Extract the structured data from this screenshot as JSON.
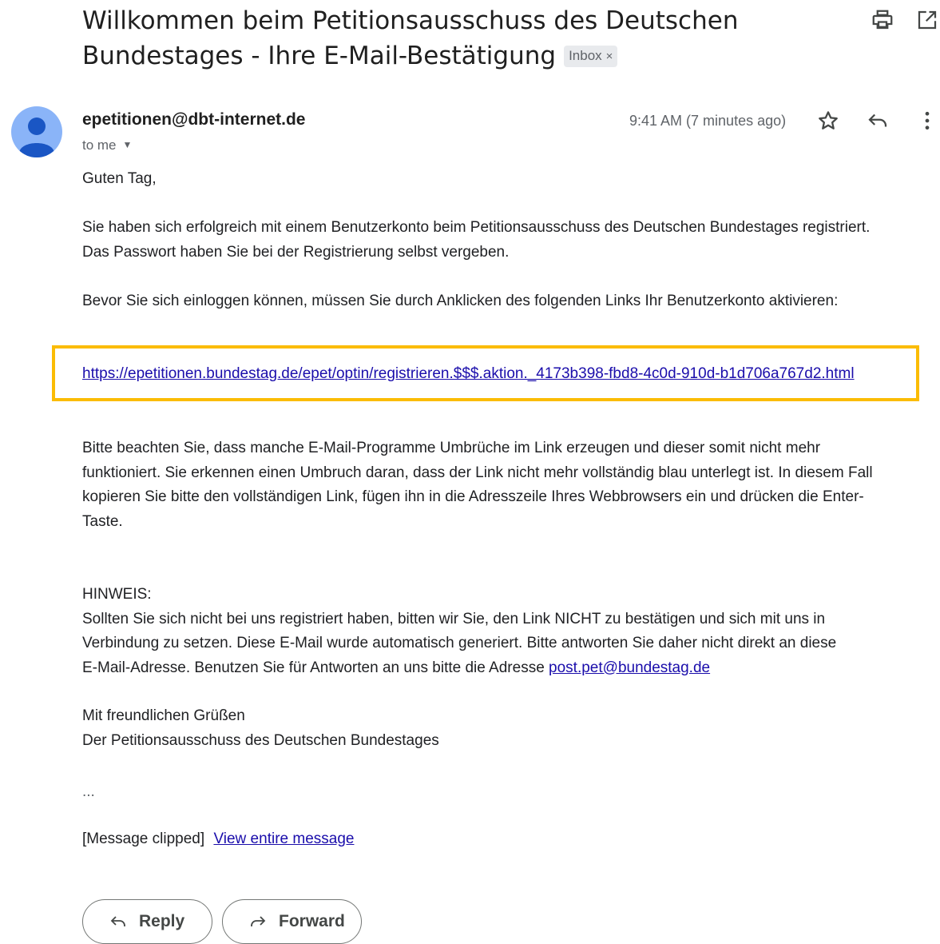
{
  "email": {
    "subject": "Willkommen beim Petitionsausschuss des Deutschen Bundestages - Ihre E-Mail-Bestätigung",
    "label": "Inbox",
    "sender": "epetitionen@dbt-internet.de",
    "recipient": "to me",
    "time": "9:41 AM (7 minutes ago)",
    "greeting": "Guten Tag,",
    "p1_line1": "Sie haben sich erfolgreich mit einem Benutzerkonto beim Petitionsausschuss des Deutschen Bundestages registriert.",
    "p1_line2": "Das Passwort haben Sie bei der Registrierung selbst vergeben.",
    "p2": "Bevor Sie sich einloggen können, müssen Sie durch Anklicken des folgenden Links Ihr Benutzerkonto aktivieren:",
    "activation_link": "https://epetitionen.bundestag.de/epet/optin/registrieren.$$$.aktion._4173b398-fbd8-4c0d-910d-b1d706a767d2.html",
    "p3_line1": "Bitte beachten Sie, dass manche E-Mail-Programme Umbrüche im Link erzeugen und dieser somit nicht mehr",
    "p3_line2": "funktioniert. Sie erkennen einen Umbruch daran, dass der Link nicht mehr vollständig blau unterlegt ist. In diesem Fall",
    "p3_line3": "kopieren Sie bitte den vollständigen Link, fügen ihn in die Adresszeile Ihres Webbrowsers ein und drücken die Enter-",
    "p3_line4": "Taste.",
    "note_heading": "HINWEIS:",
    "note_line1": "Sollten Sie sich nicht bei uns registriert haben, bitten wir Sie, den Link NICHT zu bestätigen und sich mit uns in",
    "note_line2": "Verbindung zu setzen. Diese E-Mail wurde automatisch generiert. Bitte antworten Sie daher nicht direkt an diese",
    "note_line3": "E-Mail-Adresse. Benutzen Sie für Antworten an uns bitte die Adresse",
    "contact_email": "post.pet@bundestag.de",
    "closing": "Mit freundlichen Grüßen",
    "signature": "Der Petitionsausschuss des Deutschen Bundestages",
    "ellipsis": "...",
    "clipped_text": "[Message clipped]",
    "view_entire": "View entire message"
  },
  "actions": {
    "reply": "Reply",
    "forward": "Forward"
  },
  "colors": {
    "highlight": "#fbbc04",
    "link": "#1a0dab",
    "avatar": "#8ab4f8"
  }
}
